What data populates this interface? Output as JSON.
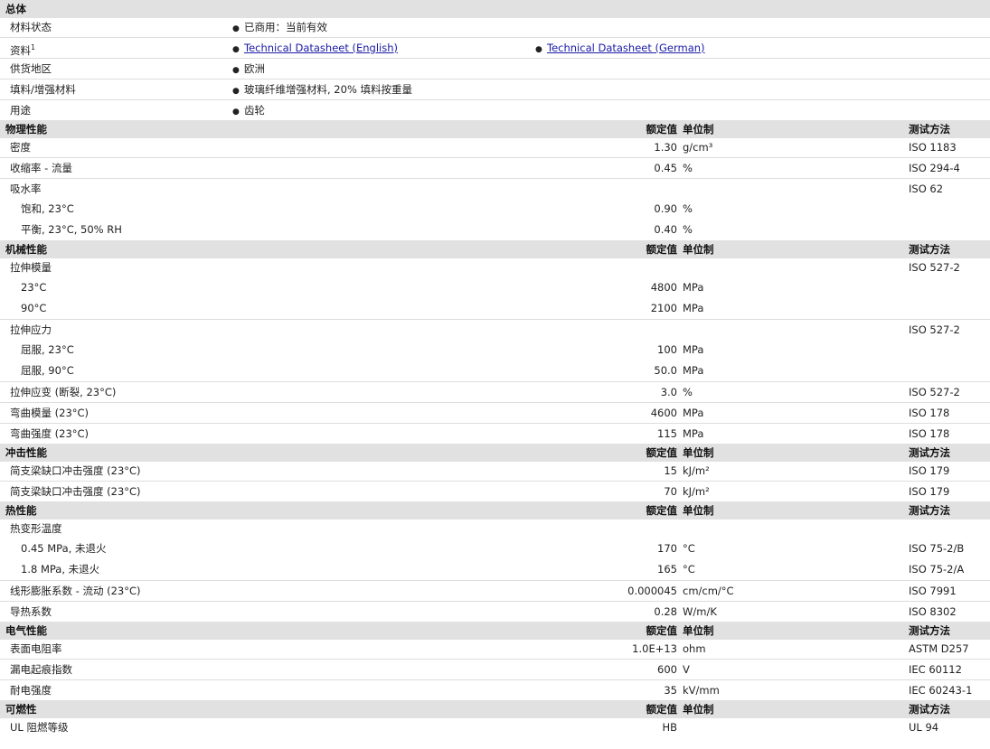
{
  "general": {
    "title": "总体",
    "rows": [
      {
        "label": "材料状态",
        "sup": "",
        "items": [
          {
            "text": "已商用：当前有效",
            "link": false
          }
        ]
      },
      {
        "label": "资料",
        "sup": "1",
        "items": [
          {
            "text": "Technical Datasheet (English)",
            "link": true
          },
          {
            "text": "Technical Datasheet (German)",
            "link": true
          }
        ]
      },
      {
        "label": "供货地区",
        "sup": "",
        "items": [
          {
            "text": "欧洲",
            "link": false
          }
        ]
      },
      {
        "label": "填料/增强材料",
        "sup": "",
        "items": [
          {
            "text": "玻璃纤维增强材料, 20% 填料按重量",
            "link": false
          }
        ]
      },
      {
        "label": "用途",
        "sup": "",
        "items": [
          {
            "text": "齿轮",
            "link": false
          }
        ]
      }
    ]
  },
  "sections": [
    {
      "title": "物理性能",
      "col_value": "额定值",
      "col_unit": "单位制",
      "col_method": "测试方法",
      "rows": [
        {
          "label": "密度",
          "value": "1.30",
          "unit": "g/cm³",
          "method": "ISO 1183",
          "indent": false,
          "sep": true
        },
        {
          "label": "收缩率 - 流量",
          "value": "0.45",
          "unit": "%",
          "method": "ISO 294-4",
          "indent": false,
          "sep": true
        },
        {
          "label": "吸水率",
          "value": "",
          "unit": "",
          "method": "ISO 62",
          "indent": false,
          "sep": true
        },
        {
          "label": "饱和, 23°C",
          "value": "0.90",
          "unit": "%",
          "method": "",
          "indent": true,
          "sep": false
        },
        {
          "label": "平衡, 23°C, 50% RH",
          "value": "0.40",
          "unit": "%",
          "method": "",
          "indent": true,
          "sep": false
        }
      ]
    },
    {
      "title": "机械性能",
      "col_value": "额定值",
      "col_unit": "单位制",
      "col_method": "测试方法",
      "rows": [
        {
          "label": "拉伸模量",
          "value": "",
          "unit": "",
          "method": "ISO 527-2",
          "indent": false,
          "sep": true
        },
        {
          "label": "23°C",
          "value": "4800",
          "unit": "MPa",
          "method": "",
          "indent": true,
          "sep": false
        },
        {
          "label": "90°C",
          "value": "2100",
          "unit": "MPa",
          "method": "",
          "indent": true,
          "sep": false
        },
        {
          "label": "拉伸应力",
          "value": "",
          "unit": "",
          "method": "ISO 527-2",
          "indent": false,
          "sep": true
        },
        {
          "label": "屈服, 23°C",
          "value": "100",
          "unit": "MPa",
          "method": "",
          "indent": true,
          "sep": false
        },
        {
          "label": "屈服, 90°C",
          "value": "50.0",
          "unit": "MPa",
          "method": "",
          "indent": true,
          "sep": false
        },
        {
          "label": "拉伸应变 (断裂, 23°C)",
          "value": "3.0",
          "unit": "%",
          "method": "ISO 527-2",
          "indent": false,
          "sep": true
        },
        {
          "label": "弯曲模量 (23°C)",
          "value": "4600",
          "unit": "MPa",
          "method": "ISO 178",
          "indent": false,
          "sep": true
        },
        {
          "label": "弯曲强度 (23°C)",
          "value": "115",
          "unit": "MPa",
          "method": "ISO 178",
          "indent": false,
          "sep": true
        }
      ]
    },
    {
      "title": "冲击性能",
      "col_value": "额定值",
      "col_unit": "单位制",
      "col_method": "测试方法",
      "rows": [
        {
          "label": "简支梁缺口冲击强度 (23°C)",
          "value": "15",
          "unit": "kJ/m²",
          "method": "ISO 179",
          "indent": false,
          "sep": true
        },
        {
          "label": "简支梁缺口冲击强度 (23°C)",
          "value": "70",
          "unit": "kJ/m²",
          "method": "ISO 179",
          "indent": false,
          "sep": true
        }
      ]
    },
    {
      "title": "热性能",
      "col_value": "额定值",
      "col_unit": "单位制",
      "col_method": "测试方法",
      "rows": [
        {
          "label": "热变形温度",
          "value": "",
          "unit": "",
          "method": "",
          "indent": false,
          "sep": true
        },
        {
          "label": "0.45 MPa, 未退火",
          "value": "170",
          "unit": "°C",
          "method": "ISO 75-2/B",
          "indent": true,
          "sep": false
        },
        {
          "label": "1.8 MPa, 未退火",
          "value": "165",
          "unit": "°C",
          "method": "ISO 75-2/A",
          "indent": true,
          "sep": false
        },
        {
          "label": "线形膨胀系数 - 流动 (23°C)",
          "value": "0.000045",
          "unit": "cm/cm/°C",
          "method": "ISO 7991",
          "indent": false,
          "sep": true
        },
        {
          "label": "导热系数",
          "value": "0.28",
          "unit": "W/m/K",
          "method": "ISO 8302",
          "indent": false,
          "sep": true
        }
      ]
    },
    {
      "title": "电气性能",
      "col_value": "额定值",
      "col_unit": "单位制",
      "col_method": "测试方法",
      "rows": [
        {
          "label": "表面电阻率",
          "value": "1.0E+13",
          "unit": "ohm",
          "method": "ASTM D257",
          "indent": false,
          "sep": true
        },
        {
          "label": "漏电起痕指数",
          "value": "600",
          "unit": "V",
          "method": "IEC 60112",
          "indent": false,
          "sep": true
        },
        {
          "label": "耐电强度",
          "value": "35",
          "unit": "kV/mm",
          "method": "IEC 60243-1",
          "indent": false,
          "sep": true
        }
      ]
    },
    {
      "title": "可燃性",
      "col_value": "额定值",
      "col_unit": "单位制",
      "col_method": "测试方法",
      "rows": [
        {
          "label": "UL 阻燃等级",
          "value": "HB",
          "unit": "",
          "method": "UL 94",
          "indent": false,
          "sep": true
        }
      ]
    }
  ]
}
